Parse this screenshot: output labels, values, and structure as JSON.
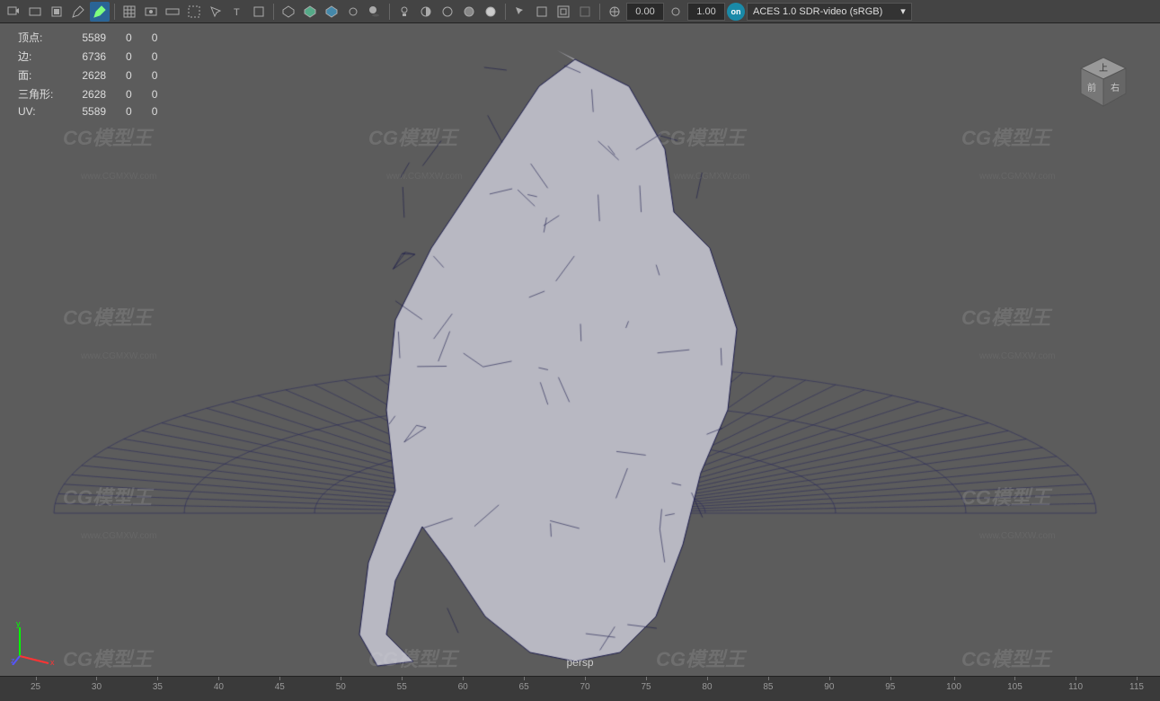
{
  "toolbar": {
    "value1": "0.00",
    "value2": "1.00",
    "on_label": "on",
    "colorspace": "ACES 1.0 SDR-video (sRGB)"
  },
  "stats": {
    "rows": [
      {
        "label": "顶点:",
        "c1": "5589",
        "c2": "0",
        "c3": "0"
      },
      {
        "label": "边:",
        "c1": "6736",
        "c2": "0",
        "c3": "0"
      },
      {
        "label": "面:",
        "c1": "2628",
        "c2": "0",
        "c3": "0"
      },
      {
        "label": "三角形:",
        "c1": "2628",
        "c2": "0",
        "c3": "0"
      },
      {
        "label": "UV:",
        "c1": "5589",
        "c2": "0",
        "c3": "0"
      }
    ]
  },
  "viewport": {
    "camera": "persp",
    "cube_front": "前",
    "cube_top": "上",
    "cube_right": "右"
  },
  "watermark": {
    "logo": "CG模型王",
    "url": "www.CGMXW.com"
  },
  "timeline": {
    "ticks": [
      25,
      30,
      35,
      40,
      45,
      50,
      55,
      60,
      65,
      70,
      75,
      80,
      85,
      90,
      95,
      100,
      105,
      110,
      115
    ]
  },
  "axis": {
    "x": "x",
    "y": "y",
    "z": "z"
  }
}
